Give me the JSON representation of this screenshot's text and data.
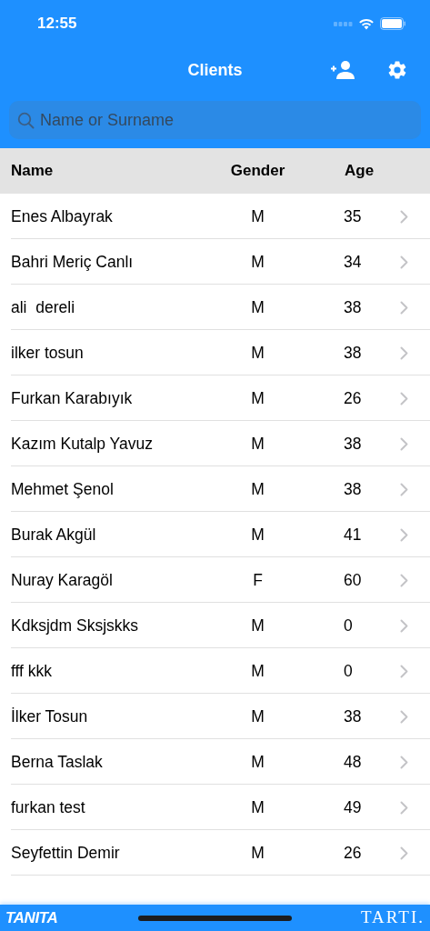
{
  "status_bar": {
    "time": "12:55"
  },
  "nav": {
    "title": "Clients"
  },
  "search": {
    "placeholder": "Name or Surname"
  },
  "table": {
    "columns": [
      "Name",
      "Gender",
      "Age"
    ],
    "rows": [
      {
        "name": "Enes Albayrak",
        "gender": "M",
        "age": "35"
      },
      {
        "name": "Bahri Meriç Canlı",
        "gender": "M",
        "age": "34"
      },
      {
        "name": "ali  dereli",
        "gender": "M",
        "age": "38"
      },
      {
        "name": "ilker tosun",
        "gender": "M",
        "age": "38"
      },
      {
        "name": "Furkan Karabıyık",
        "gender": "M",
        "age": "26"
      },
      {
        "name": "Kazım Kutalp Yavuz",
        "gender": "M",
        "age": "38"
      },
      {
        "name": "Mehmet Şenol",
        "gender": "M",
        "age": "38"
      },
      {
        "name": "Burak Akgül",
        "gender": "M",
        "age": "41"
      },
      {
        "name": "Nuray Karagöl",
        "gender": "F",
        "age": "60"
      },
      {
        "name": "Kdksjdm Sksjskks",
        "gender": "M",
        "age": "0"
      },
      {
        "name": "fff kkk",
        "gender": "M",
        "age": "0"
      },
      {
        "name": "İlker Tosun",
        "gender": "M",
        "age": "38"
      },
      {
        "name": "Berna Taslak",
        "gender": "M",
        "age": "48"
      },
      {
        "name": "furkan test",
        "gender": "M",
        "age": "49"
      },
      {
        "name": "Seyfettin Demir",
        "gender": "M",
        "age": "26"
      }
    ]
  },
  "footer": {
    "left_logo": "TANITA",
    "right_logo": "TARTI."
  }
}
